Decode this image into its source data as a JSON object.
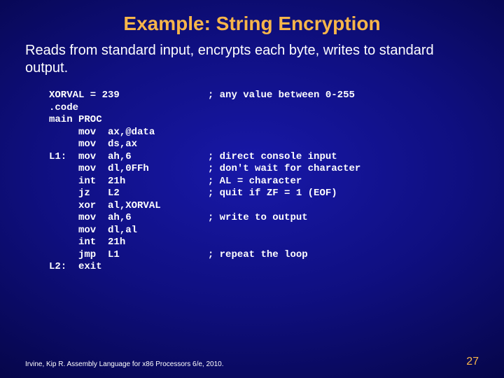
{
  "title": "Example: String Encryption",
  "body": "Reads from standard input, encrypts each byte, writes to standard output.",
  "code": "XORVAL = 239               ; any value between 0-255\n.code\nmain PROC\n     mov  ax,@data\n     mov  ds,ax\nL1:  mov  ah,6             ; direct console input\n     mov  dl,0FFh          ; don't wait for character\n     int  21h              ; AL = character\n     jz   L2               ; quit if ZF = 1 (EOF)\n     xor  al,XORVAL\n     mov  ah,6             ; write to output\n     mov  dl,al\n     int  21h\n     jmp  L1               ; repeat the loop\nL2:  exit",
  "footer": "Irvine, Kip R. Assembly Language for x86 Processors 6/e, 2010.",
  "pagenum": "27"
}
